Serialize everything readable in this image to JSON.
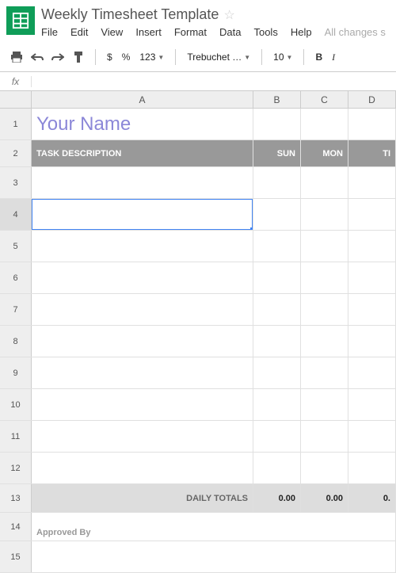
{
  "header": {
    "doc_title": "Weekly Timesheet Template",
    "menu": [
      "File",
      "Edit",
      "View",
      "Insert",
      "Format",
      "Data",
      "Tools",
      "Help"
    ],
    "save_status": "All changes s"
  },
  "toolbar": {
    "currency": "$",
    "percent": "%",
    "numfmt": "123",
    "font": "Trebuchet …",
    "size": "10",
    "bold": "B",
    "italic": "I"
  },
  "fx": {
    "label": "fx"
  },
  "columns": [
    "A",
    "B",
    "C",
    "D"
  ],
  "sheet": {
    "name_title": "Your Name",
    "hdr": {
      "task": "TASK DESCRIPTION",
      "sun": "SUN",
      "mon": "MON",
      "tue": "TI"
    },
    "totals_label": "DAILY TOTALS",
    "totals": {
      "b": "0.00",
      "c": "0.00",
      "d": "0."
    },
    "approved": "Approved By"
  },
  "row_nums": [
    "1",
    "2",
    "3",
    "4",
    "5",
    "6",
    "7",
    "8",
    "9",
    "10",
    "11",
    "12",
    "13",
    "14",
    "15"
  ]
}
